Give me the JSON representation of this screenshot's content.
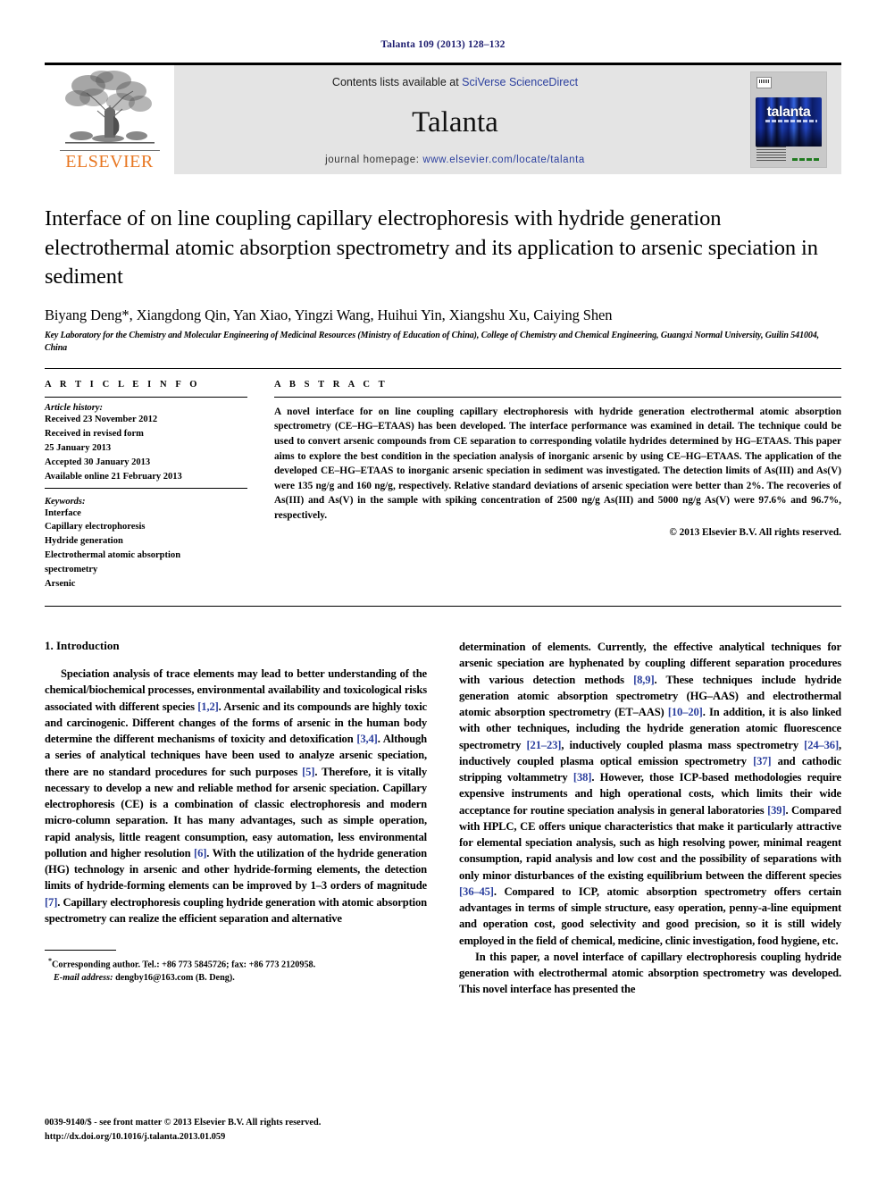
{
  "running_head": "Talanta 109 (2013) 128–132",
  "masthead": {
    "publisher_logo_text": "ELSEVIER",
    "contents_prefix": "Contents lists available at ",
    "contents_link": "SciVerse ScienceDirect",
    "journal_name": "Talanta",
    "homepage_prefix": "journal homepage: ",
    "homepage_url": "www.elsevier.com/locate/talanta",
    "cover_title": "talanta"
  },
  "article": {
    "title": "Interface of on line coupling capillary electrophoresis with hydride generation electrothermal atomic absorption spectrometry and its application to arsenic speciation in sediment",
    "authors": "Biyang Deng*, Xiangdong Qin, Yan Xiao, Yingzi Wang, Huihui Yin, Xiangshu Xu, Caiying Shen",
    "affiliation": "Key Laboratory for the Chemistry and Molecular Engineering of Medicinal Resources (Ministry of Education of China), College of Chemistry and Chemical Engineering, Guangxi Normal University, Guilin 541004, China"
  },
  "article_info": {
    "heading": "A R T I C L E   I N F O",
    "history_label": "Article history:",
    "history_lines": [
      "Received 23 November 2012",
      "Received in revised form",
      "25 January 2013",
      "Accepted 30 January 2013",
      "Available online 21 February 2013"
    ],
    "keywords_label": "Keywords:",
    "keywords": [
      "Interface",
      "Capillary electrophoresis",
      "Hydride generation",
      "Electrothermal atomic absorption",
      "spectrometry",
      "Arsenic"
    ]
  },
  "abstract": {
    "heading": "A B S T R A C T",
    "text": "A novel interface for on line coupling capillary electrophoresis with hydride generation electrothermal atomic absorption spectrometry (CE–HG–ETAAS) has been developed. The interface performance was examined in detail. The technique could be used to convert arsenic compounds from CE separation to corresponding volatile hydrides determined by HG–ETAAS. This paper aims to explore the best condition in the speciation analysis of inorganic arsenic by using CE–HG–ETAAS. The application of the developed CE–HG–ETAAS to inorganic arsenic speciation in sediment was investigated. The detection limits of As(III) and As(V) were 135 ng/g and 160 ng/g, respectively. Relative standard deviations of arsenic speciation were better than 2%. The recoveries of As(III) and As(V) in the sample with spiking concentration of 2500 ng/g As(III) and 5000 ng/g As(V) were 97.6% and 96.7%, respectively.",
    "copyright": "© 2013 Elsevier B.V. All rights reserved."
  },
  "introduction": {
    "section_title": "1.  Introduction",
    "left_paragraph_1_a": "Speciation analysis of trace elements may lead to better understanding of the chemical/biochemical processes, environmental availability and toxicological risks associated with different species ",
    "ref_1_2": "[1,2]",
    "left_paragraph_1_b": ". Arsenic and its compounds are highly toxic and carcinogenic. Different changes of the forms of arsenic in the human body determine the different mechanisms of toxicity and detoxification ",
    "ref_3_4": "[3,4]",
    "left_paragraph_1_c": ". Although a series of analytical techniques have been used to analyze arsenic speciation, there are no standard procedures for such purposes ",
    "ref_5": "[5]",
    "left_paragraph_1_d": ". Therefore, it is vitally necessary to develop a new and reliable method for arsenic speciation. Capillary electrophoresis (CE) is a combination of classic electrophoresis and modern micro-column separation. It has many advantages, such as simple operation, rapid analysis, little reagent consumption, easy automation, less environmental pollution and higher resolution ",
    "ref_6": "[6]",
    "left_paragraph_1_e": ". With the utilization of the hydride generation (HG) technology in arsenic and other hydride-forming elements, the detection limits of hydride-forming elements can be improved by 1–3 orders of magnitude ",
    "ref_7": "[7]",
    "left_paragraph_1_f": ". Capillary electrophoresis coupling hydride generation with atomic absorption spectrometry can realize the efficient separation and alternative",
    "right_paragraph_1_a": "determination of elements. Currently, the effective analytical techniques for arsenic speciation are hyphenated by coupling different separation procedures with various detection methods ",
    "ref_8_9": "[8,9]",
    "right_paragraph_1_b": ". These techniques include hydride generation atomic absorption spectrometry (HG–AAS) and electrothermal atomic absorption spectrometry (ET–AAS) ",
    "ref_10_20": "[10–20]",
    "right_paragraph_1_c": ". In addition, it is also linked with other techniques, including the hydride generation atomic fluorescence spectrometry ",
    "ref_21_23": "[21–23]",
    "right_paragraph_1_d": ", inductively coupled plasma mass spectrometry ",
    "ref_24_36": "[24–36]",
    "right_paragraph_1_e": ", inductively coupled plasma optical emission spectrometry ",
    "ref_37": "[37]",
    "right_paragraph_1_f": " and cathodic stripping voltammetry ",
    "ref_38": "[38]",
    "right_paragraph_1_g": ". However, those ICP-based methodologies require expensive instruments and high operational costs, which limits their wide acceptance for routine speciation analysis in general laboratories ",
    "ref_39": "[39]",
    "right_paragraph_1_h": ". Compared with HPLC, CE offers unique characteristics that make it particularly attractive for elemental speciation analysis, such as high resolving power, minimal reagent consumption, rapid analysis and low cost and the possibility of separations with only minor disturbances of the existing equilibrium between the different species ",
    "ref_36_45": "[36–45]",
    "right_paragraph_1_i": ". Compared to ICP, atomic absorption spectrometry offers certain advantages in terms of simple structure, easy operation, penny-a-line equipment and operation cost, good selectivity and good precision, so it is still widely employed in the field of chemical, medicine, clinic investigation, food hygiene, etc.",
    "right_paragraph_2": "In this paper, a novel interface of capillary electrophoresis coupling hydride generation with electrothermal atomic absorption spectrometry was developed. This novel interface has presented the"
  },
  "footnote": {
    "star": "*",
    "corresponding": "Corresponding author. Tel.: +86 773 5845726; fax: +86 773 2120958.",
    "email_label": "E-mail address:",
    "email": " dengby16@163.com (B. Deng)."
  },
  "legal": {
    "issn_line": "0039-9140/$ - see front matter © 2013 Elsevier B.V. All rights reserved.",
    "doi_line": "http://dx.doi.org/10.1016/j.talanta.2013.01.059"
  },
  "colors": {
    "link_blue": "#2b3f9e",
    "running_head_navy": "#1b1b6e",
    "elsevier_orange": "#E87722",
    "masthead_grey": "#e4e4e4"
  }
}
